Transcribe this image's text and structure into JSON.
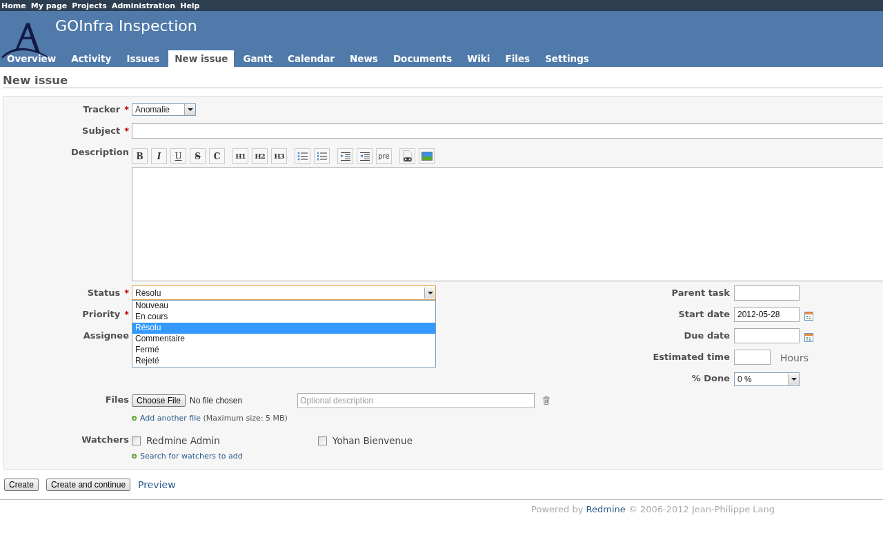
{
  "top_menu": [
    {
      "label": "Home"
    },
    {
      "label": "My page"
    },
    {
      "label": "Projects"
    },
    {
      "label": "Administration"
    },
    {
      "label": "Help"
    }
  ],
  "project": {
    "title": "GOInfra Inspection"
  },
  "tabs": [
    {
      "label": "Overview",
      "selected": false
    },
    {
      "label": "Activity",
      "selected": false
    },
    {
      "label": "Issues",
      "selected": false
    },
    {
      "label": "New issue",
      "selected": true
    },
    {
      "label": "Gantt",
      "selected": false
    },
    {
      "label": "Calendar",
      "selected": false
    },
    {
      "label": "News",
      "selected": false
    },
    {
      "label": "Documents",
      "selected": false
    },
    {
      "label": "Wiki",
      "selected": false
    },
    {
      "label": "Files",
      "selected": false
    },
    {
      "label": "Settings",
      "selected": false
    }
  ],
  "page_title": "New issue",
  "form": {
    "required_mark": "*",
    "tracker": {
      "label": "Tracker",
      "required": true,
      "value": "Anomalie"
    },
    "subject": {
      "label": "Subject",
      "required": true
    },
    "description": {
      "label": "Description",
      "toolbar": [
        {
          "kind": "bold",
          "label": "B"
        },
        {
          "kind": "italic",
          "label": "I"
        },
        {
          "kind": "underline",
          "label": "U"
        },
        {
          "kind": "strike",
          "label": "S"
        },
        {
          "kind": "code",
          "label": "C"
        },
        {
          "kind": "heading",
          "label": "H1"
        },
        {
          "kind": "heading",
          "label": "H2"
        },
        {
          "kind": "heading",
          "label": "H3"
        },
        {
          "kind": "bullet-list"
        },
        {
          "kind": "numbered-list"
        },
        {
          "kind": "indent"
        },
        {
          "kind": "outdent"
        },
        {
          "kind": "pre",
          "label": "pre"
        },
        {
          "kind": "link"
        },
        {
          "kind": "image"
        }
      ]
    },
    "status": {
      "label": "Status",
      "required": true,
      "value": "Résolu",
      "expanded": true,
      "options": [
        {
          "label": "Nouveau",
          "selected": false
        },
        {
          "label": "En cours",
          "selected": false
        },
        {
          "label": "Résolu",
          "selected": true
        },
        {
          "label": "Commentaire",
          "selected": false
        },
        {
          "label": "Fermé",
          "selected": false
        },
        {
          "label": "Rejeté",
          "selected": false
        }
      ]
    },
    "priority": {
      "label": "Priority",
      "required": true
    },
    "assignee": {
      "label": "Assignee",
      "required": false
    },
    "parent_task": {
      "label": "Parent task"
    },
    "start_date": {
      "label": "Start date",
      "value": "2012-05-28"
    },
    "due_date": {
      "label": "Due date"
    },
    "estimated_time": {
      "label": "Estimated time",
      "unit": "Hours"
    },
    "done_ratio": {
      "label": "% Done",
      "value": "0 %"
    },
    "files": {
      "label": "Files",
      "button": "Choose File",
      "status": "No file chosen",
      "placeholder": "Optional description",
      "add_link": "Add another file",
      "note": "(Maximum size: 5 MB)"
    },
    "watchers": {
      "label": "Watchers",
      "users": [
        {
          "name": "Redmine Admin",
          "checked": false
        },
        {
          "name": "Yohan Bienvenue",
          "checked": false
        }
      ],
      "search_link": "Search for watchers to add"
    }
  },
  "actions": [
    {
      "kind": "button",
      "label": "Create"
    },
    {
      "kind": "button",
      "label": "Create and continue"
    },
    {
      "kind": "link",
      "label": "Preview"
    }
  ],
  "footer": {
    "prefix": "Powered by",
    "link": "Redmine",
    "suffix": "© 2006-2012 Jean-Philippe Lang"
  }
}
